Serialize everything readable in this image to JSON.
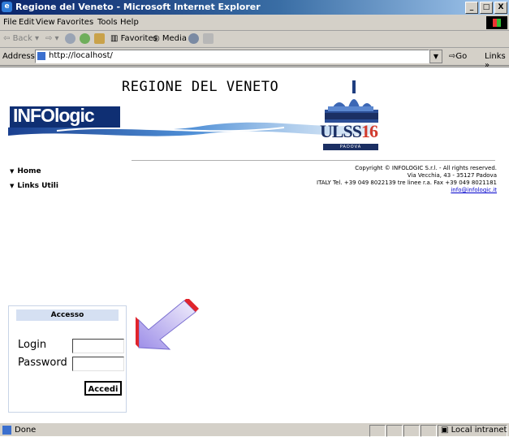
{
  "window": {
    "title": "Regione del Veneto - Microsoft Internet Explorer",
    "controls": [
      "_",
      "□",
      "X"
    ]
  },
  "menu": [
    "File",
    "Edit",
    "View",
    "Favorites",
    "Tools",
    "Help"
  ],
  "toolbar": {
    "back": "Back",
    "favorites": "Favorites",
    "media": "Media"
  },
  "address": {
    "label": "Address",
    "url": "http://localhost/",
    "go": "Go",
    "links": "Links"
  },
  "page": {
    "header_title": "REGIONE DEL VENETO",
    "logo_text_a": "INFO",
    "logo_text_b": "logic",
    "uls_text_a": "ULSS",
    "uls_text_b": "16",
    "uls_city": "PADOVA",
    "nav": [
      {
        "label": "Home"
      },
      {
        "label": "Links Utili"
      }
    ],
    "copyright": {
      "line1": "Copyright © INFOLOGIC S.r.l. - All rights reserved.",
      "line2": "Via Vecchia, 43 - 35127 Padova",
      "line3": "ITALY Tel. +39 049 8022139 tre linee r.a. Fax +39 049 8021181",
      "email": "info@infologic.it"
    },
    "login": {
      "heading": "Accesso",
      "login_label": "Login",
      "password_label": "Password",
      "submit_label": "Accedi"
    }
  },
  "status": {
    "text": "Done",
    "zone": "Local intranet"
  }
}
